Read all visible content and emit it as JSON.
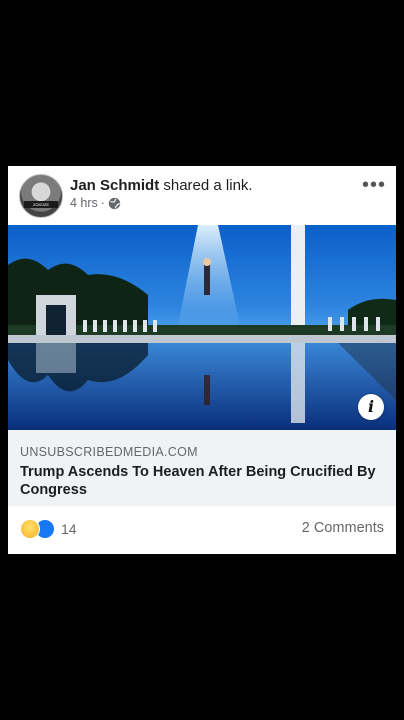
{
  "post": {
    "author": "Jan Schmidt",
    "action": "shared a link.",
    "time": "4 hrs",
    "separator": "·",
    "avatar_badge": "ZOIGIZE"
  },
  "link": {
    "domain": "UNSUBSCRIBEDMEDIA.COM",
    "title": "Trump Ascends To Heaven After Being Crucified By Congress"
  },
  "footer": {
    "reaction_count": "14",
    "comments": "2 Comments"
  },
  "icons": {
    "more": "more-options-icon",
    "globe": "globe-icon",
    "info": "info-icon",
    "reactions": [
      "haha-icon",
      "like-icon"
    ]
  }
}
